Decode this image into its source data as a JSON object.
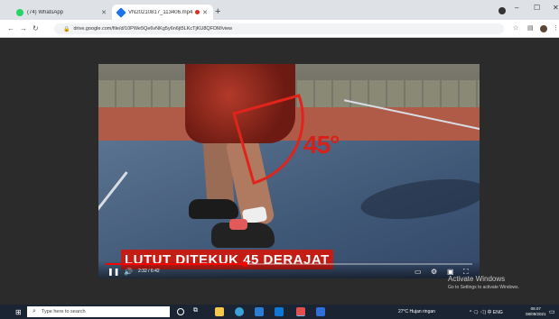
{
  "browser": {
    "tabs": [
      {
        "label": "(74) WhatsApp",
        "favicon_color": "#25d366"
      },
      {
        "label": "VN20210817_113406.mp4 -",
        "favicon_color": "#1a73e8"
      }
    ],
    "url": "drive.google.com/file/d/10PWe5Qe6vNKg5y6n6jt5LKcTjKU8QFDM/view",
    "window_controls": {
      "minimize": "–",
      "maximize": "☐",
      "close": "✕"
    },
    "icons": [
      "back-icon",
      "forward-icon",
      "reload-icon",
      "lock-icon",
      "star-icon",
      "extensions-icon",
      "profile-icon",
      "menu-icon"
    ]
  },
  "video": {
    "overlay_angle": "45°",
    "caption": "LUTUT DITEKUK 45 DERAJAT",
    "time": "2:32 / 6:42",
    "progress_fraction": 0.38,
    "accent_color": "#c41d16"
  },
  "watermark": {
    "line1": "Activate Windows",
    "line2": "Go to Settings to activate Windows."
  },
  "taskbar": {
    "search_placeholder": "Type here to search",
    "weather": "27°C  Hujan ringan",
    "system_tray": "^ 🗨 ◁) 中 ENG",
    "time": "08.07",
    "date": "08/09/2021"
  }
}
